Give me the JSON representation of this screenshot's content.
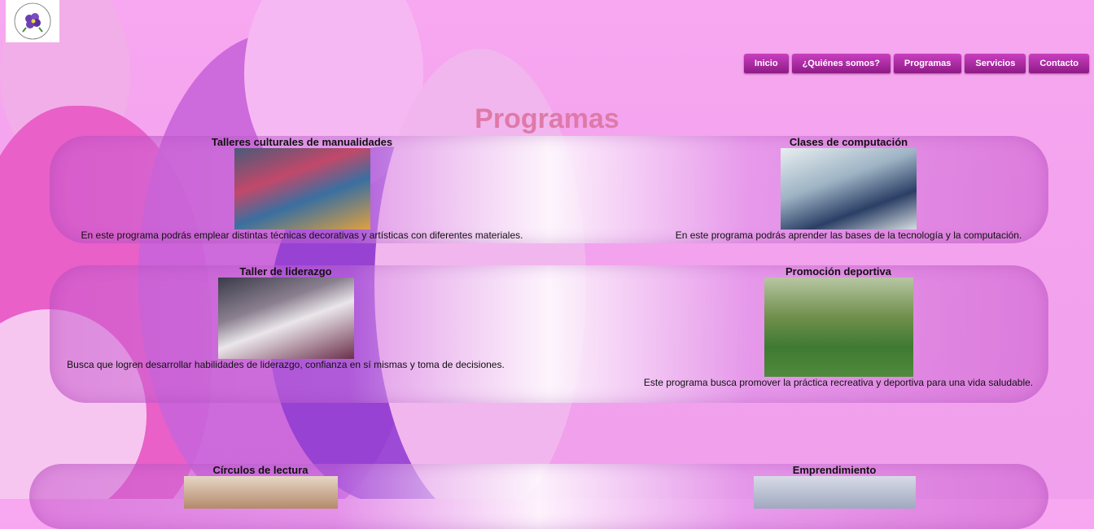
{
  "logo": {
    "alt": "logo-flower-icon"
  },
  "nav": {
    "items": [
      {
        "label": "Inicio"
      },
      {
        "label": "¿Quiénes somos?"
      },
      {
        "label": "Programas"
      },
      {
        "label": "Servicios"
      },
      {
        "label": "Contacto"
      }
    ]
  },
  "page": {
    "title": "Programas"
  },
  "programs": [
    {
      "title": "Talleres culturales de manualidades",
      "description": "En este programa podrás emplear distintas técnicas decorativas y artísticas con diferentes materiales."
    },
    {
      "title": "Clases de computación",
      "description": "En este programa podrás aprender las bases de la tecnología y la computación."
    },
    {
      "title": "Taller de liderazgo",
      "description": "Busca que logren desarrollar habilidades de liderazgo, confianza en sí mismas y toma de decisiones."
    },
    {
      "title": "Promoción deportiva",
      "description": "Este programa busca promover la práctica recreativa y deportiva para una vida saludable."
    },
    {
      "title": "Círculos de lectura",
      "description": ""
    },
    {
      "title": "Emprendimiento",
      "description": ""
    }
  ],
  "colors": {
    "accent": "#8e1a86",
    "title": "#de7aa8"
  }
}
